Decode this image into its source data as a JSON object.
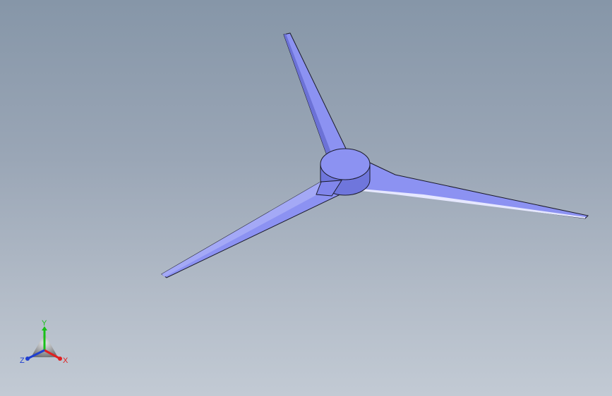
{
  "axis_triad": {
    "y_label": "Y",
    "x_label": "X",
    "z_label": "Z",
    "colors": {
      "x": "#e02020",
      "y": "#18c018",
      "z": "#1f3fd0"
    }
  },
  "model": {
    "part_color": "#8c92f2",
    "part_shade": "#6c72d6",
    "edge_color": "#1a1a2a"
  }
}
